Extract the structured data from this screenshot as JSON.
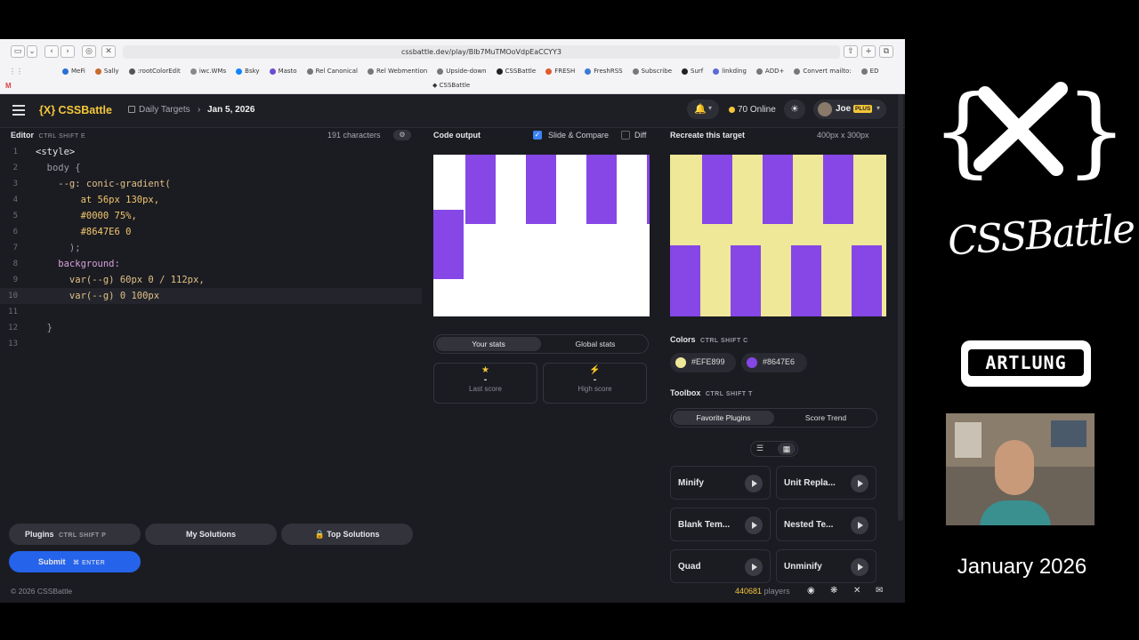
{
  "browser": {
    "url": "cssbattle.dev/play/Blb7MuTMOoVdpEaCCYY3",
    "bookmarks": [
      {
        "label": "MeFi",
        "color": "#2b6fd6"
      },
      {
        "label": "Sally",
        "color": "#c96b2c"
      },
      {
        "label": ":rootColorEdit",
        "color": "#555555"
      },
      {
        "label": "iwc.WMs",
        "color": "#888888"
      },
      {
        "label": "Bsky",
        "color": "#1185fe"
      },
      {
        "label": "Masto",
        "color": "#6d4bd3"
      },
      {
        "label": "Rel Canonical",
        "color": "#777777"
      },
      {
        "label": "Rel Webmention",
        "color": "#777777"
      },
      {
        "label": "Upside-down",
        "color": "#777777"
      },
      {
        "label": "CSSBattle",
        "color": "#222222"
      },
      {
        "label": "FRESH",
        "color": "#e35a2c"
      },
      {
        "label": "FreshRSS",
        "color": "#3a7bd5"
      },
      {
        "label": "Subscribe",
        "color": "#777777"
      },
      {
        "label": "Surf",
        "color": "#222222"
      },
      {
        "label": "linkding",
        "color": "#5b6bd6"
      },
      {
        "label": "ADD+",
        "color": "#777777"
      },
      {
        "label": "Convert mailto:",
        "color": "#777777"
      },
      {
        "label": "ED",
        "color": "#777777"
      }
    ],
    "active_tab": "CSSBattle"
  },
  "header": {
    "logo": "{X} CSSBattle",
    "breadcrumb_section": "Daily Targets",
    "breadcrumb_date": "Jan 5, 2026",
    "online_count": "70 Online",
    "user_name": "Joe",
    "plus_badge": "PLUS"
  },
  "editor": {
    "title": "Editor",
    "shortcut": "CTRL SHIFT E",
    "char_count": "191 characters",
    "lines": [
      {
        "n": "1",
        "text": "<style>"
      },
      {
        "n": "2",
        "text": "  body {"
      },
      {
        "n": "3",
        "text": "    --g: conic-gradient("
      },
      {
        "n": "4",
        "text": "        at 56px 130px,"
      },
      {
        "n": "5",
        "text": "        #0000 75%,"
      },
      {
        "n": "6",
        "text": "        #8647E6 0"
      },
      {
        "n": "7",
        "text": "      );"
      },
      {
        "n": "8",
        "text": "    background:"
      },
      {
        "n": "9",
        "text": "      var(--g) 60px 0 / 112px,"
      },
      {
        "n": "10",
        "text": "      var(--g) 0 100px"
      },
      {
        "n": "11",
        "text": ""
      },
      {
        "n": "12",
        "text": "  }"
      },
      {
        "n": "13",
        "text": ""
      }
    ]
  },
  "output": {
    "title": "Code output",
    "slide_compare": "Slide & Compare",
    "diff": "Diff"
  },
  "target": {
    "title": "Recreate this target",
    "size": "400px x 300px",
    "bg_color": "#EFE899",
    "fg_color": "#8647E6"
  },
  "stats": {
    "tab_your": "Your stats",
    "tab_global": "Global stats",
    "last_score_value": "-",
    "last_score_label": "Last score",
    "high_score_value": "-",
    "high_score_label": "High score"
  },
  "colors": {
    "title": "Colors",
    "shortcut": "CTRL SHIFT C",
    "swatches": [
      "#EFE899",
      "#8647E6"
    ]
  },
  "toolbox": {
    "title": "Toolbox",
    "shortcut": "CTRL SHIFT T",
    "tab_favorite": "Favorite Plugins",
    "tab_trend": "Score Trend",
    "plugins": [
      "Minify",
      "Unit Repla...",
      "Blank Tem...",
      "Nested Te...",
      "Quad",
      "Unminify"
    ]
  },
  "footer": {
    "plugins_label": "Plugins",
    "plugins_shortcut": "CTRL SHIFT P",
    "my_solutions": "My Solutions",
    "top_solutions": "Top Solutions",
    "submit": "Submit",
    "submit_shortcut": "ENTER",
    "copyright": "© 2026 CSSBattle",
    "players_count": "440681",
    "players_label": "players"
  },
  "stream": {
    "date_caption": "January 2026",
    "logo_text": "CSSBattle",
    "artlung": "ARTLUNG"
  }
}
